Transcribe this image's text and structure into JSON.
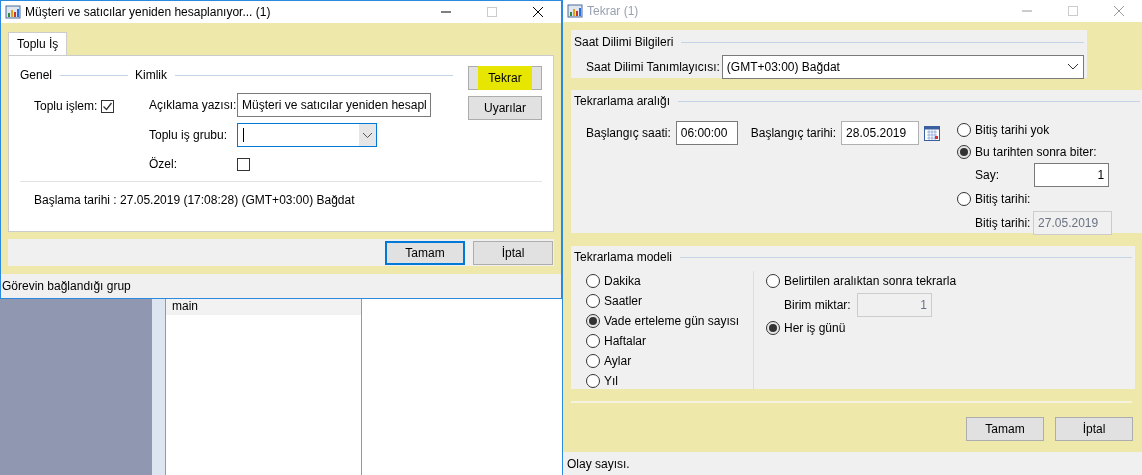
{
  "background": {
    "list_item": "main"
  },
  "batch_dialog": {
    "title": "Müşteri ve satıcılar yeniden hesaplanıyor... (1)",
    "active": true,
    "tabs": [
      {
        "label": "Toplu İş",
        "selected": true
      }
    ],
    "sections": {
      "general": "Genel",
      "identity": "Kimlik"
    },
    "batch_processing": {
      "label": "Toplu işlem:",
      "checked": true
    },
    "description": {
      "label": "Açıklama yazısı:",
      "value": "Müşteri ve satıcılar yeniden hesapl"
    },
    "batch_group": {
      "label": "Toplu iş grubu:",
      "focused": true
    },
    "private": {
      "label": "Özel:",
      "checked": false
    },
    "start_info": "Başlama tarihi : 27.05.2019 (17:08:28) (GMT+03:00) Bağdat",
    "side_buttons": [
      {
        "label": "Tekrar",
        "highlighted": true
      },
      {
        "label": "Uyarılar",
        "highlighted": false
      }
    ],
    "buttons": [
      {
        "label": "Tamam",
        "default": true
      },
      {
        "label": "İptal",
        "default": false
      }
    ],
    "status_bar": "Görevin bağlandığı grup"
  },
  "recurrence_dialog": {
    "title": "Tekrar (1)",
    "active": false,
    "time_zone": {
      "heading": "Saat Dilimi Bilgileri",
      "label": "Saat Dilimi Tanımlayıcısı:",
      "value": "(GMT+03:00) Bağdat"
    },
    "range": {
      "heading": "Tekrarlama aralığı",
      "start_time": {
        "label": "Başlangıç saati:",
        "value": "06:00:00"
      },
      "start_date": {
        "label": "Başlangıç tarihi:",
        "value": "28.05.2019"
      },
      "end_options": [
        {
          "label": "Bitiş tarihi yok",
          "selected": false
        },
        {
          "label": "Bu tarihten sonra biter:",
          "selected": true
        },
        {
          "label": "Bitiş tarihi:",
          "selected": false
        }
      ],
      "count": {
        "label": "Say:",
        "value": "1"
      },
      "end_date": {
        "label": "Bitiş tarihi:",
        "value": "27.05.2019",
        "disabled": true
      }
    },
    "pattern": {
      "heading": "Tekrarlama modeli",
      "units": [
        {
          "label": "Dakika",
          "selected": false
        },
        {
          "label": "Saatler",
          "selected": false
        },
        {
          "label": "Vade erteleme gün sayısı",
          "selected": true
        },
        {
          "label": "Haftalar",
          "selected": false
        },
        {
          "label": "Aylar",
          "selected": false
        },
        {
          "label": "Yıl",
          "selected": false
        }
      ],
      "modes": [
        {
          "label": "Belirtilen aralıktan sonra tekrarla",
          "selected": false
        },
        {
          "label": "Her iş günü",
          "selected": true
        }
      ],
      "unit_amount": {
        "label": "Birim miktar:",
        "value": "1",
        "disabled": true
      }
    },
    "buttons": [
      {
        "label": "Tamam",
        "default": false
      },
      {
        "label": "İptal",
        "default": false
      }
    ],
    "status_bar": "Olay sayısı."
  }
}
